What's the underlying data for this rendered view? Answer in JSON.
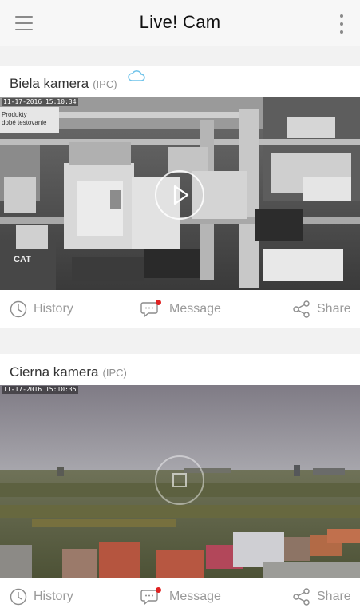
{
  "app": {
    "title": "Live! Cam"
  },
  "cameras": [
    {
      "name": "Biela kamera",
      "type": "(IPC)",
      "cloud": true,
      "timestamp": "11-17-2016 15:10:34",
      "overlay_lines": [
        "Produkty",
        "dobé testovanie"
      ],
      "box_label": "CAT",
      "control": "play",
      "actions": {
        "history": "History",
        "message": "Message",
        "share": "Share"
      },
      "message_unread": true
    },
    {
      "name": "Cierna kamera",
      "type": "(IPC)",
      "cloud": false,
      "timestamp": "11-17-2016 15:10:35",
      "control": "stop",
      "actions": {
        "history": "History",
        "message": "Message",
        "share": "Share"
      },
      "message_unread": true
    }
  ],
  "colors": {
    "background": "#f2f2f2",
    "card": "#ffffff",
    "unread_dot": "#e02222",
    "cloud": "#6fc3ea",
    "action_text": "#9a9a9a"
  }
}
